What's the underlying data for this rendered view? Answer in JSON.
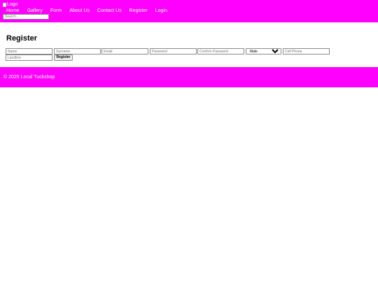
{
  "header": {
    "logo_alt": "Logo",
    "nav": [
      "Home",
      "Gallery",
      "Form",
      "About Us",
      "Contact Us",
      "Register",
      "Login"
    ],
    "search_placeholder": "Search..."
  },
  "main": {
    "title": "Register",
    "form": {
      "name_placeholder": "Name",
      "surname_placeholder": "Surname",
      "email_placeholder": "Email",
      "password_placeholder": "Password",
      "confirm_password_placeholder": "Confirm Password",
      "gender_selected": "Male",
      "cell_phone_placeholder": "Cell Phone",
      "landline_placeholder": "Landline",
      "submit_label": "Register"
    }
  },
  "footer": {
    "text": "© 2025 Local Tuckshop"
  },
  "colors": {
    "header_bg": "#ff00ff",
    "footer_bg": "#ff00ff",
    "nav_text": "#ffffff"
  }
}
